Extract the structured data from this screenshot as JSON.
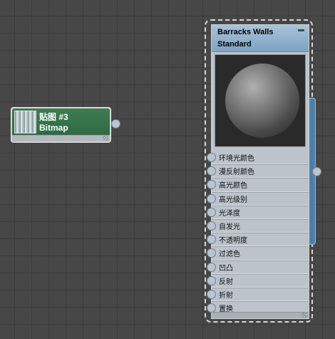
{
  "bitmap_node": {
    "title": "贴图 #3",
    "type": "Bitmap"
  },
  "material_node": {
    "title": "Barracks Walls",
    "type": "Standard",
    "slots": [
      "环境光颜色",
      "漫反射颜色",
      "高光颜色",
      "高光级别",
      "光泽度",
      "自发光",
      "不透明度",
      "过滤色",
      "凹凸",
      "反射",
      "折射",
      "置换"
    ]
  },
  "colors": {
    "bitmap_header": "#2f6a44",
    "material_header": "#7ea2c2",
    "selection_strip": "#4f7fa8",
    "canvas": "#474747"
  }
}
